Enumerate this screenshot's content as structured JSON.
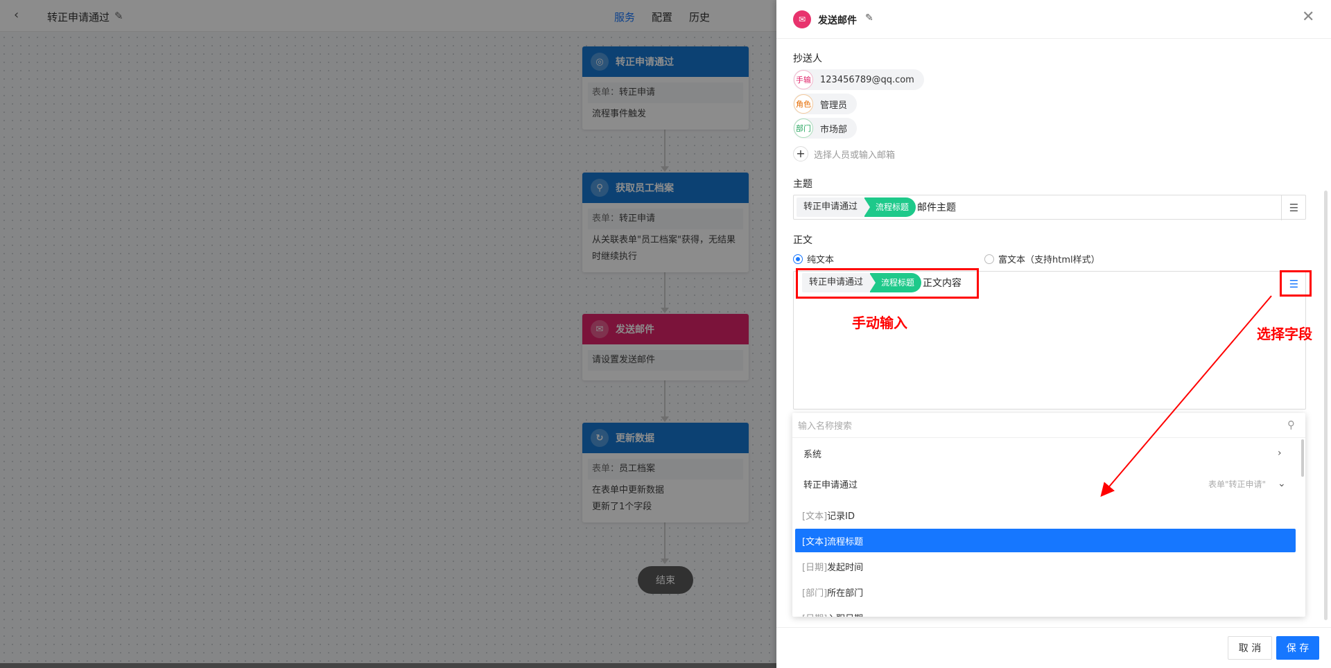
{
  "topbar": {
    "flow_title": "转正申请通过",
    "tabs": [
      {
        "label": "服务",
        "active": true
      },
      {
        "label": "配置",
        "active": false
      },
      {
        "label": "历史",
        "active": false
      }
    ]
  },
  "nodes": [
    {
      "title": "转正申请通过",
      "icon": "target-icon",
      "rows": [
        {
          "key": "表单：",
          "value": "转正申请"
        }
      ],
      "desc": [
        "流程事件触发"
      ]
    },
    {
      "title": "获取员工档案",
      "icon": "search-icon",
      "rows": [
        {
          "key": "表单：",
          "value": "转正申请"
        }
      ],
      "desc": [
        "从关联表单\"员工档案\"获得，无结果",
        "时继续执行"
      ]
    },
    {
      "title": "发送邮件",
      "icon": "mail-icon",
      "rows": [
        {
          "key": "请设置发送邮件",
          "value": ""
        }
      ],
      "desc": []
    },
    {
      "title": "更新数据",
      "icon": "refresh-icon",
      "rows": [
        {
          "key": "表单：",
          "value": "员工档案"
        }
      ],
      "desc": [
        "在表单中更新数据",
        "更新了1个字段"
      ]
    }
  ],
  "end_label": "结束",
  "panel": {
    "title": "发送邮件",
    "cc_label": "抄送人",
    "recipients": [
      {
        "tag": "手输",
        "text": "123456789@qq.com"
      },
      {
        "tag": "角色",
        "text": "管理员"
      },
      {
        "tag": "部门",
        "text": "市场部"
      }
    ],
    "add_placeholder": "选择人员或输入邮箱",
    "subject_label": "主题",
    "subject": {
      "token_plain": "转正申请通过",
      "token_field": "流程标题",
      "text": "邮件主题"
    },
    "body_label": "正文",
    "body_modes": [
      {
        "label": "纯文本",
        "selected": true
      },
      {
        "label": "富文本（支持html样式）",
        "selected": false
      }
    ],
    "body": {
      "token_plain": "转正申请通过",
      "token_field": "流程标题",
      "text": "正文内容"
    },
    "annotations": {
      "manual": "手动输入",
      "pick": "选择字段"
    },
    "dropdown": {
      "search_placeholder": "输入名称搜索",
      "groups": [
        {
          "label": "系统",
          "hint": ""
        },
        {
          "label": "转正申请通过",
          "hint": "表单\"转正申请\""
        }
      ],
      "items": [
        {
          "type": "[文本]",
          "name": "记录ID",
          "selected": false
        },
        {
          "type": "[文本]",
          "name": "流程标题",
          "selected": true
        },
        {
          "type": "[日期]",
          "name": "发起时间",
          "selected": false
        },
        {
          "type": "[部门]",
          "name": "所在部门",
          "selected": false
        },
        {
          "type": "[日期]",
          "name": "入职日期",
          "selected": false
        }
      ]
    },
    "footer": {
      "cancel": "取 消",
      "save": "保 存"
    }
  }
}
